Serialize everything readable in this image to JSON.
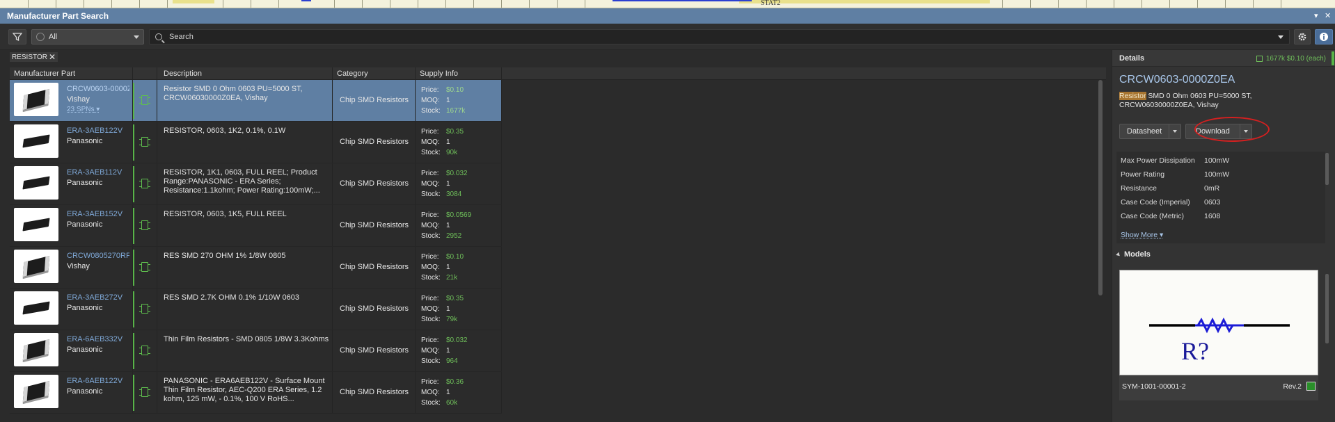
{
  "window": {
    "title": "Manufacturer Part Search"
  },
  "toolbar": {
    "scope_value": "All",
    "search_placeholder": "Search",
    "filter_tag": "RESISTOR"
  },
  "table": {
    "headers": {
      "part": "Manufacturer Part",
      "description": "Description",
      "category": "Category",
      "supply": "Supply Info"
    },
    "labels": {
      "price": "Price:",
      "moq": "MOQ:",
      "stock": "Stock:"
    },
    "rows": [
      {
        "part": "CRCW0603-0000Z",
        "manufacturer": "Vishay",
        "spns": "23 SPNs",
        "description": "Resistor SMD 0 Ohm 0603 PU=5000 ST, CRCW06030000Z0EA, Vishay",
        "category": "Chip SMD Resistors",
        "price": "$0.10",
        "moq": "1",
        "stock": "1677k"
      },
      {
        "part": "ERA-3AEB122V",
        "manufacturer": "Panasonic",
        "spns": "",
        "description": "RESISTOR, 0603, 1K2, 0.1%, 0.1W",
        "category": "Chip SMD Resistors",
        "price": "$0.35",
        "moq": "1",
        "stock": "90k"
      },
      {
        "part": "ERA-3AEB112V",
        "manufacturer": "Panasonic",
        "spns": "",
        "description": "RESISTOR, 1K1, 0603,  FULL REEL; Product Range:PANASONIC - ERA Series; Resistance:1.1kohm; Power Rating:100mW;...",
        "category": "Chip SMD Resistors",
        "price": "$0.032",
        "moq": "1",
        "stock": "3084"
      },
      {
        "part": "ERA-3AEB152V",
        "manufacturer": "Panasonic",
        "spns": "",
        "description": "RESISTOR, 0603, 1K5, FULL REEL",
        "category": "Chip SMD Resistors",
        "price": "$0.0569",
        "moq": "1",
        "stock": "2952"
      },
      {
        "part": "CRCW0805270RFI",
        "manufacturer": "Vishay",
        "spns": "",
        "description": "RES SMD 270 OHM 1% 1/8W 0805",
        "category": "Chip SMD Resistors",
        "price": "$0.10",
        "moq": "1",
        "stock": "21k"
      },
      {
        "part": "ERA-3AEB272V",
        "manufacturer": "Panasonic",
        "spns": "",
        "description": "RES SMD 2.7K OHM 0.1% 1/10W 0603",
        "category": "Chip SMD Resistors",
        "price": "$0.35",
        "moq": "1",
        "stock": "79k"
      },
      {
        "part": "ERA-6AEB332V",
        "manufacturer": "Panasonic",
        "spns": "",
        "description": "Thin Film Resistors - SMD 0805 1/8W 3.3Kohms",
        "category": "Chip SMD Resistors",
        "price": "$0.032",
        "moq": "1",
        "stock": "964"
      },
      {
        "part": "ERA-6AEB122V",
        "manufacturer": "Panasonic",
        "spns": "",
        "description": "PANASONIC - ERA6AEB122V - Surface Mount Thin Film Resistor, AEC-Q200 ERA Series, 1.2 kohm, 125 mW, - 0.1%, 100 V RoHS...",
        "category": "Chip SMD Resistors",
        "price": "$0.36",
        "moq": "1",
        "stock": "60k"
      }
    ]
  },
  "details": {
    "title": "Details",
    "summary_stock": "1677k",
    "summary_price": "$0.10 (each)",
    "part": "CRCW0603-0000Z0EA",
    "desc_highlight": "Resistor",
    "desc_rest": " SMD 0 Ohm 0603 PU=5000 ST, CRCW06030000Z0EA, Vishay",
    "datasheet_label": "Datasheet",
    "download_label": "Download",
    "params": [
      {
        "name": "Max Power Dissipation",
        "value": "100mW"
      },
      {
        "name": "Power Rating",
        "value": "100mW"
      },
      {
        "name": "Resistance",
        "value": "0mR"
      },
      {
        "name": "Case Code (Imperial)",
        "value": "0603"
      },
      {
        "name": "Case Code (Metric)",
        "value": "1608"
      }
    ],
    "show_more": "Show More",
    "models_title": "Models",
    "symbol_designator": "R?",
    "symbol_name": "SYM-1001-00001-2",
    "symbol_rev": "Rev.2"
  },
  "colors": {
    "accent": "#5f7fa3",
    "price_green": "#6fbf5a",
    "link_blue": "#7fa9d8",
    "annotation_red": "#d42020"
  },
  "background": {
    "top_strip_text": "STAT2"
  }
}
